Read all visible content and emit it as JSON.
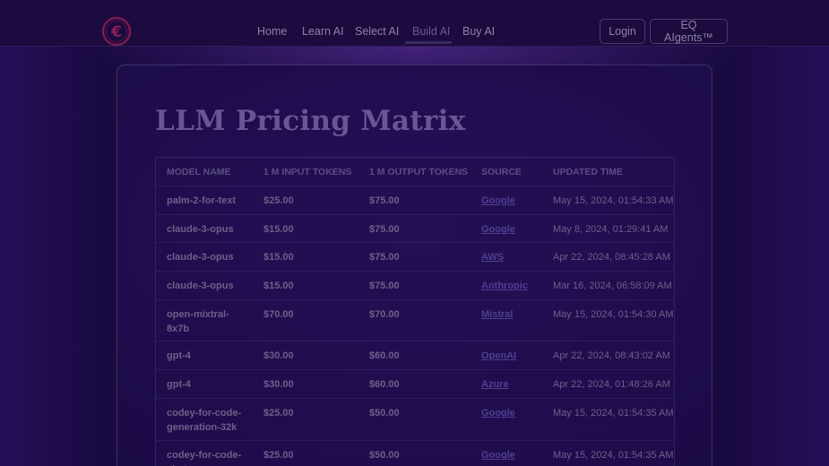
{
  "brand": {
    "logo_letter": "€",
    "logo_color": "#8a1f5a"
  },
  "nav": {
    "items": [
      {
        "label": "Home"
      },
      {
        "label": "Learn AI"
      },
      {
        "label": "Select AI"
      },
      {
        "label": "Build AI",
        "active": true
      },
      {
        "label": "Buy AI"
      }
    ]
  },
  "header_actions": {
    "login_label": "Login",
    "agents_label": "EQ AIgents™"
  },
  "page": {
    "title": "LLM Pricing Matrix"
  },
  "table": {
    "columns": [
      "MODEL NAME",
      "1 M INPUT TOKENS",
      "1 M OUTPUT TOKENS",
      "SOURCE",
      "UPDATED TIME"
    ],
    "rows": [
      {
        "model": "palm-2-for-text",
        "input": "$25.00",
        "output": "$75.00",
        "source": "Google",
        "updated": "May 15, 2024, 01:54:33 AM"
      },
      {
        "model": "claude-3-opus",
        "input": "$15.00",
        "output": "$75.00",
        "source": "Google",
        "updated": "May 8, 2024, 01:29:41 AM"
      },
      {
        "model": "claude-3-opus",
        "input": "$15.00",
        "output": "$75.00",
        "source": "AWS",
        "updated": "Apr 22, 2024, 08:45:28 AM"
      },
      {
        "model": "claude-3-opus",
        "input": "$15.00",
        "output": "$75.00",
        "source": "Anthropic",
        "updated": "Mar 16, 2024, 06:58:09 AM"
      },
      {
        "model": "open-mixtral-8x7b",
        "input": "$70.00",
        "output": "$70.00",
        "source": "Mistral",
        "updated": "May 15, 2024, 01:54:30 AM"
      },
      {
        "model": "gpt-4",
        "input": "$30.00",
        "output": "$60.00",
        "source": "OpenAI",
        "updated": "Apr 22, 2024, 08:43:02 AM"
      },
      {
        "model": "gpt-4",
        "input": "$30.00",
        "output": "$60.00",
        "source": "Azure",
        "updated": "Apr 22, 2024, 01:48:26 AM"
      },
      {
        "model": "codey-for-code-generation-32k",
        "input": "$25.00",
        "output": "$50.00",
        "source": "Google",
        "updated": "May 15, 2024, 01:54:35 AM"
      },
      {
        "model": "codey-for-code-chat",
        "input": "$25.00",
        "output": "$50.00",
        "source": "Google",
        "updated": "May 15, 2024, 01:54:35 AM"
      }
    ]
  }
}
